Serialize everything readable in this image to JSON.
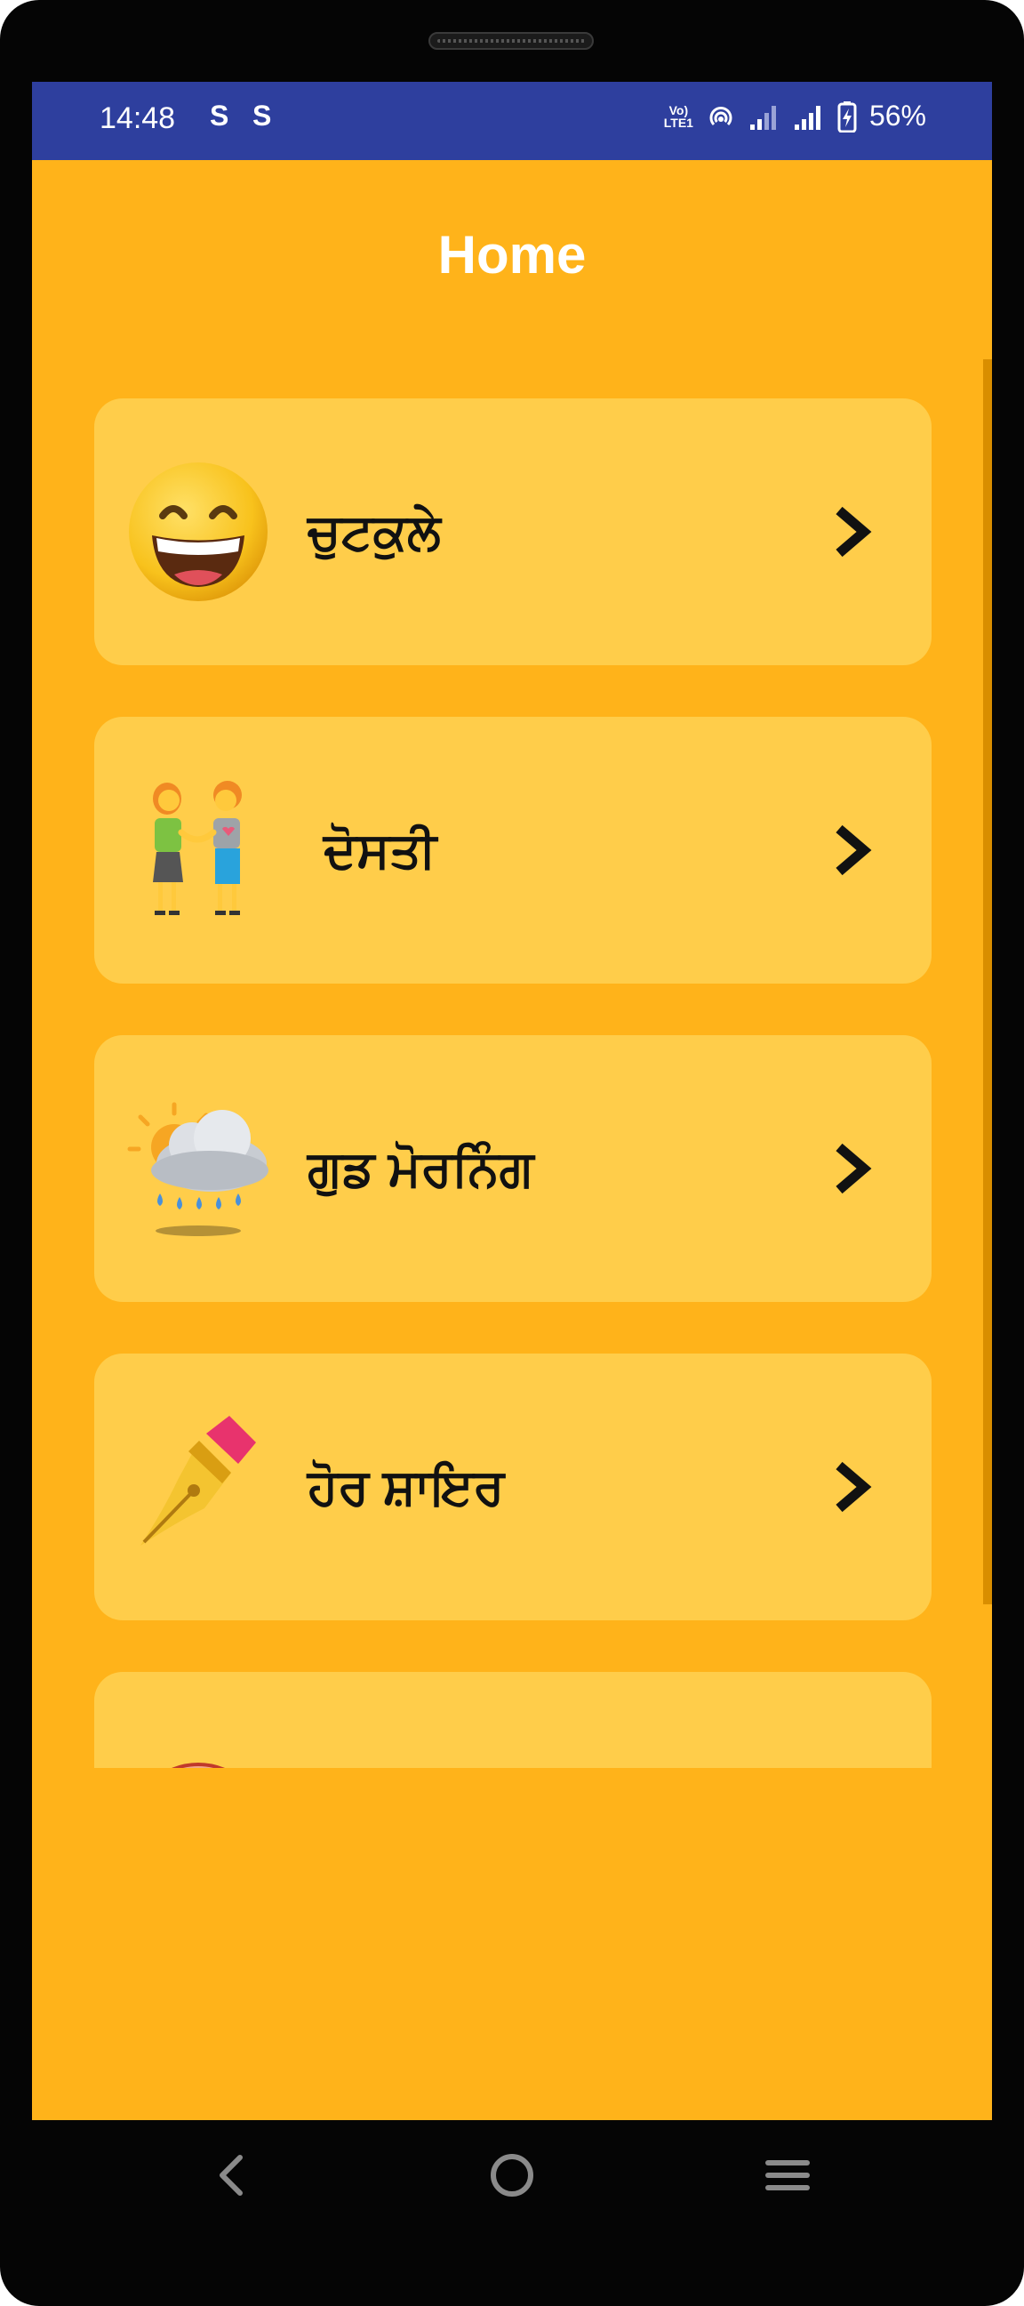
{
  "status_bar": {
    "time": "14:48",
    "notification_icons": [
      "S",
      "S"
    ],
    "volte_label_top": "Vo)",
    "volte_label_bottom": "LTE1",
    "battery_percent": "56%"
  },
  "page": {
    "title": "Home"
  },
  "menu": {
    "items": [
      {
        "label": "ਚੁਟਕੁਲੇ",
        "icon": "grinning-face-icon"
      },
      {
        "label": "ਦੋਸਤੀ",
        "icon": "two-women-holding-hands-icon"
      },
      {
        "label": "ਗੁਡ ਮੋਰਨਿੰਗ",
        "icon": "sun-behind-rain-cloud-icon"
      },
      {
        "label": "ਹੋਰ ਸ਼ਾਇਰ",
        "icon": "fountain-pen-icon"
      },
      {
        "label": "",
        "icon": "partial-face-icon"
      }
    ]
  },
  "nav_bar": {
    "buttons": [
      "back-icon",
      "home-icon",
      "recent-apps-icon"
    ]
  },
  "colors": {
    "status_bar": "#2E3F9E",
    "background": "#FFB31A",
    "card": "#FFCD4A",
    "text_dark": "#111111",
    "title": "#FFFFFF"
  }
}
